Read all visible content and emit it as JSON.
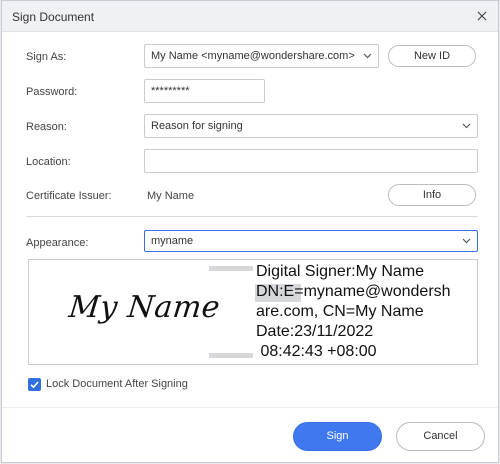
{
  "dialog": {
    "title": "Sign Document"
  },
  "form": {
    "sign_as": {
      "label": "Sign As:",
      "value": "My Name <myname@wondershare.com>"
    },
    "new_id_button": "New ID",
    "password": {
      "label": "Password:",
      "value": "*********"
    },
    "reason": {
      "label": "Reason:",
      "value": "Reason for signing"
    },
    "location": {
      "label": "Location:",
      "value": ""
    },
    "certificate_issuer": {
      "label": "Certificate Issuer:",
      "value": "My Name"
    },
    "info_button": "Info",
    "appearance": {
      "label": "Appearance:",
      "value": "myname"
    }
  },
  "preview": {
    "handwritten_name": "My Name",
    "lines": [
      "Digital Signer:My Name",
      "DN:E=myname@wondersh",
      "are.com, CN=My Name",
      "Date:23/11/2022",
      " 08:42:43 +08:00"
    ]
  },
  "lock_option": {
    "label": "Lock Document After Signing",
    "checked": true
  },
  "buttons": {
    "sign": "Sign",
    "cancel": "Cancel"
  },
  "colors": {
    "accent": "#3f78ef",
    "checkbox": "#2f6fe0",
    "title_bar": "#f0f1f4"
  },
  "icons": {
    "close": "close-icon",
    "dropdown": "chevron-down-icon",
    "check": "check-icon"
  }
}
